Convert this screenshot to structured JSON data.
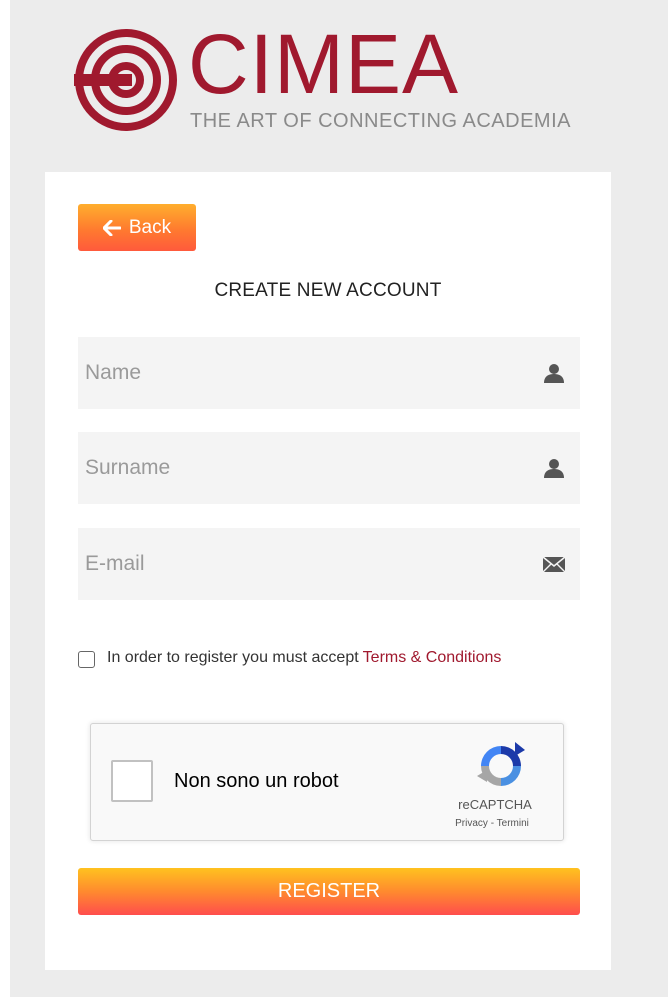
{
  "logo": {
    "word": "CIMEA",
    "tagline": "THE ART OF CONNECTING ACADEMIA"
  },
  "back_button": {
    "label": "Back",
    "icon": "arrow-left-icon"
  },
  "form": {
    "title": "CREATE NEW ACCOUNT",
    "name": {
      "placeholder": "Name",
      "value": "",
      "icon": "user-icon"
    },
    "surname": {
      "placeholder": "Surname",
      "value": "",
      "icon": "user-icon"
    },
    "email": {
      "placeholder": "E-mail",
      "value": "",
      "icon": "envelope-icon"
    },
    "terms": {
      "text": "In order to register you must accept",
      "link": "Terms & Conditions",
      "checked": false
    },
    "register_label": "REGISTER"
  },
  "recaptcha": {
    "label": "Non sono un robot",
    "brand": "reCAPTCHA",
    "links": "Privacy - Termini",
    "icon": "recaptcha-icon"
  },
  "colors": {
    "brand": "#a0192e",
    "tagline": "#8a8a8a",
    "button_gradient": [
      "#ffc21f",
      "#ff8a2e",
      "#ff4d4d"
    ],
    "field_background": "#f4f4f4",
    "page_background": "#ececec"
  }
}
